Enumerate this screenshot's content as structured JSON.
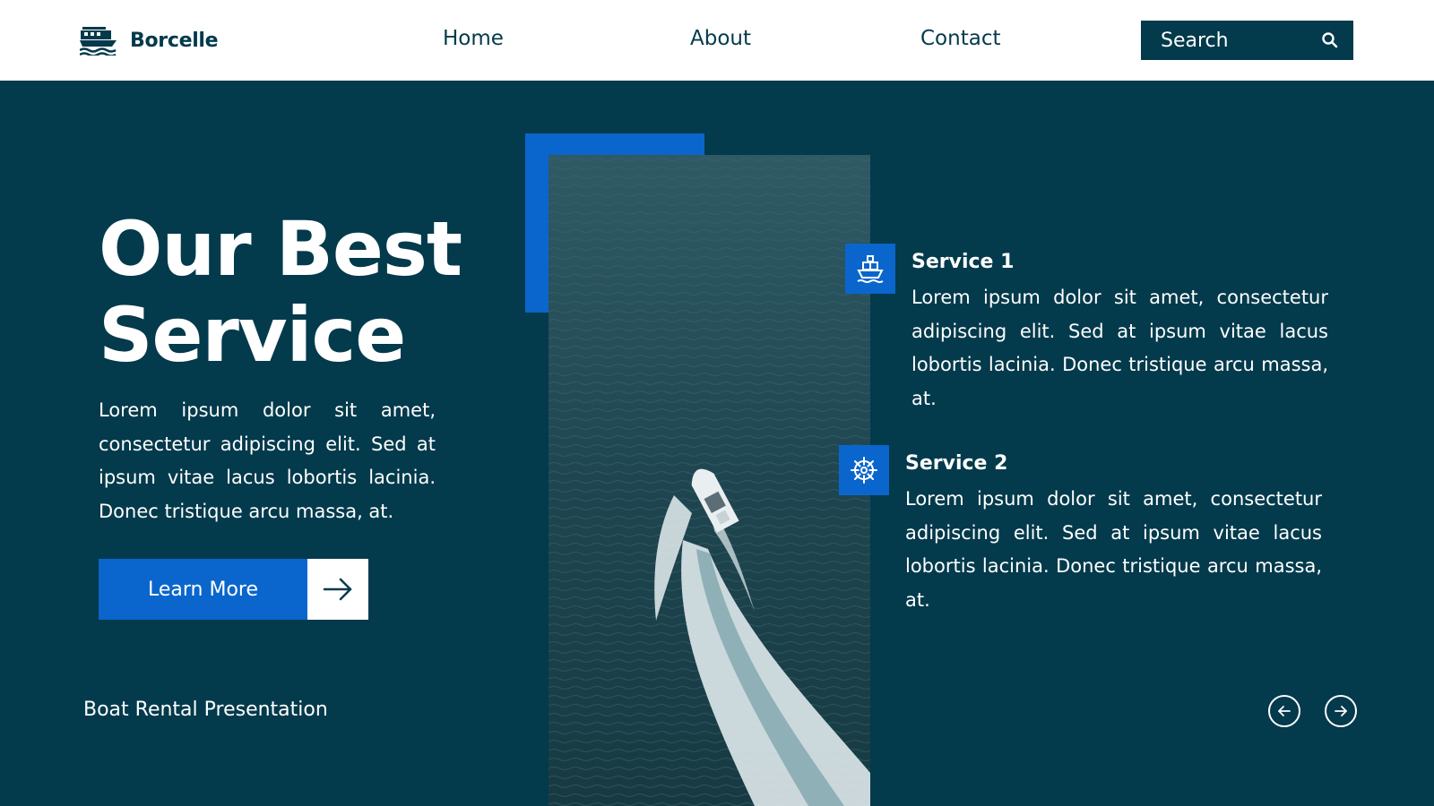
{
  "header": {
    "brand": "Borcelle",
    "nav": {
      "home": "Home",
      "about": "About",
      "contact": "Contact"
    },
    "search_label": "Search"
  },
  "hero": {
    "title_line1": "Our Best",
    "title_line2": "Service",
    "description": "Lorem ipsum dolor sit amet, consectetur adipiscing elit. Sed at ipsum vitae lacus lobortis lacinia. Donec tristique arcu massa, at.",
    "cta_label": "Learn More"
  },
  "services": [
    {
      "title": "Service 1",
      "description": "Lorem ipsum dolor sit amet, consectetur adipiscing elit. Sed at ipsum vitae lacus lobortis lacinia. Donec tristique arcu massa, at.",
      "icon": "ship-icon"
    },
    {
      "title": "Service 2",
      "description": "Lorem ipsum dolor sit amet, consectetur adipiscing elit. Sed at ipsum vitae lacus lobortis lacinia. Donec tristique arcu massa, at.",
      "icon": "ship-wheel-icon"
    }
  ],
  "footer": {
    "label": "Boat Rental Presentation"
  },
  "colors": {
    "background": "#033a4c",
    "accent": "#0a66cc",
    "header_bg": "#ffffff"
  }
}
